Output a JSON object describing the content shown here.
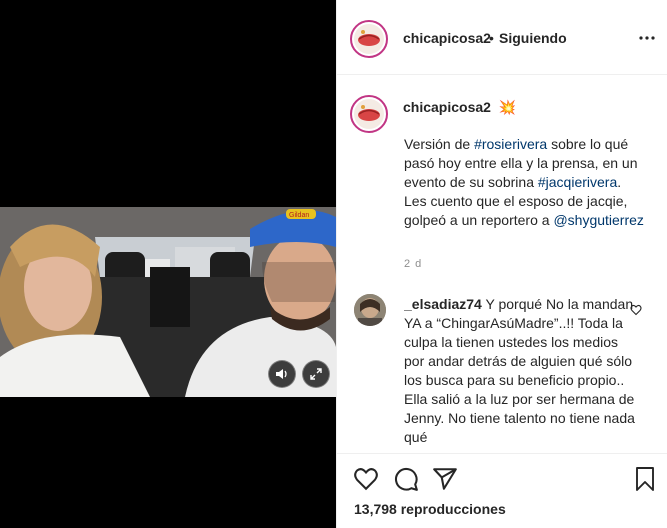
{
  "post": {
    "username": "chicapicosa2",
    "separator": "•",
    "follow_status": "Siguiendo",
    "more_icon": "more-horizontal-icon"
  },
  "caption": {
    "username": "chicapicosa2",
    "emoji": "💥",
    "text_1": "Versión de ",
    "hashtag_1": "#rosierivera",
    "text_2": " sobre lo qué pasó hoy entre ella y la prensa, en un evento de su sobrina ",
    "hashtag_2": "#jacqierivera",
    "text_3": ". Les cuento que el esposo de jacqie, golpeó a un reportero a ",
    "mention": "@shygutierrez",
    "time": "2 d"
  },
  "comment": {
    "username": "_elsadiaz74",
    "text": "Y porqué No la mandan YA a “ChingarAsúMadre”..!! Toda la culpa la tienen ustedes los medios por andar detrás de alguien qué sólo los busca para su beneficio propio.. Ella salió a la luz por ser hermana de Jenny. No tiene talento no tiene nada qué"
  },
  "actions": {
    "views": "13,798 reproducciones",
    "icons": [
      "heart-icon",
      "comment-icon",
      "share-icon",
      "bookmark-icon"
    ]
  },
  "video": {
    "cap_text": "Gildan",
    "controls": [
      "volume-icon",
      "fullscreen-icon"
    ]
  },
  "colors": {
    "link": "#00376b",
    "muted": "#8e8e8e",
    "text": "#262626",
    "ring": "#c13584"
  }
}
